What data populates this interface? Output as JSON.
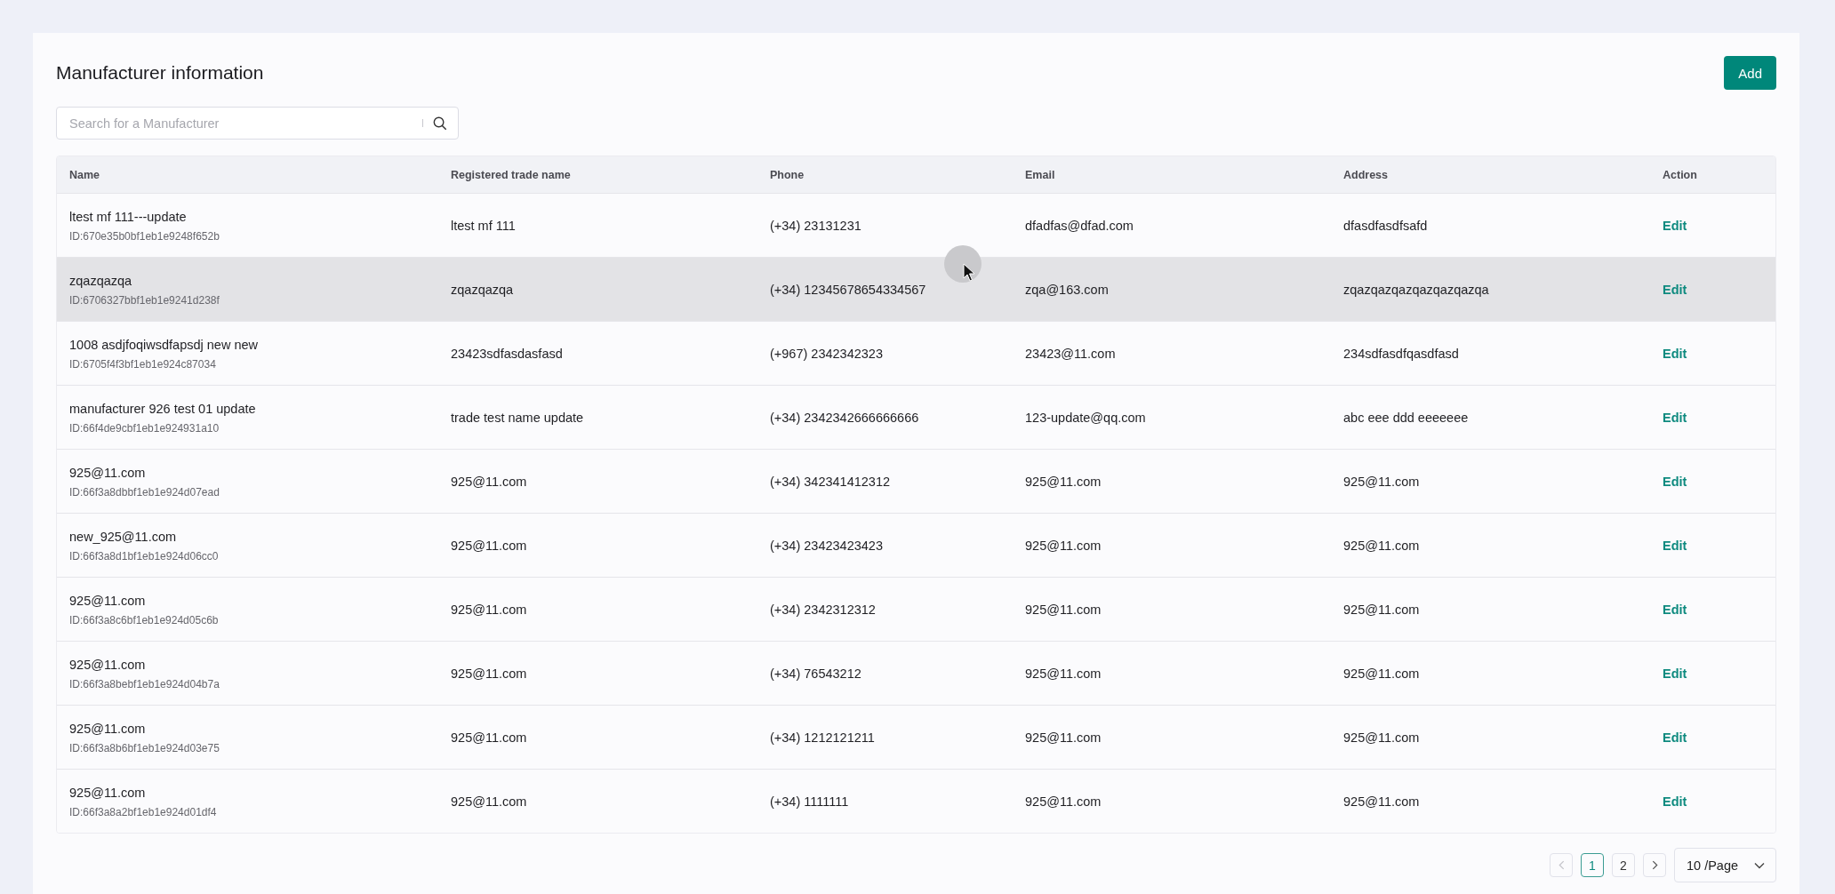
{
  "page": {
    "title": "Manufacturer information",
    "add_button": "Add"
  },
  "search": {
    "placeholder": "Search for a Manufacturer"
  },
  "table": {
    "columns": [
      "Name",
      "Registered trade name",
      "Phone",
      "Email",
      "Address",
      "Action"
    ],
    "rows": [
      {
        "name": "ltest mf 111---update",
        "id": "ID:670e35b0bf1eb1e9248f652b",
        "trade_name": "ltest mf 111",
        "phone": "(+34) 23131231",
        "email": "dfadfas@dfad.com",
        "address": "dfasdfasdfsafd",
        "action": "Edit",
        "highlighted": false
      },
      {
        "name": "zqazqazqa",
        "id": "ID:6706327bbf1eb1e9241d238f",
        "trade_name": "zqazqazqa",
        "phone": "(+34) 12345678654334567",
        "email": "zqa@163.com",
        "address": "zqazqazqazqazqazqazqa",
        "action": "Edit",
        "highlighted": true
      },
      {
        "name": "1008 asdjfoqiwsdfapsdj new new",
        "id": "ID:6705f4f3bf1eb1e924c87034",
        "trade_name": "23423sdfasdasfasd",
        "phone": "(+967) 2342342323",
        "email": "23423@11.com",
        "address": "234sdfasdfqasdfasd",
        "action": "Edit",
        "highlighted": false
      },
      {
        "name": "manufacturer 926 test 01 update",
        "id": "ID:66f4de9cbf1eb1e924931a10",
        "trade_name": "trade test name update",
        "phone": "(+34) 2342342666666666",
        "email": "123-update@qq.com",
        "address": "abc eee ddd eeeeeee",
        "action": "Edit",
        "highlighted": false
      },
      {
        "name": "925@11.com",
        "id": "ID:66f3a8dbbf1eb1e924d07ead",
        "trade_name": "925@11.com",
        "phone": "(+34) 342341412312",
        "email": "925@11.com",
        "address": "925@11.com",
        "action": "Edit",
        "highlighted": false
      },
      {
        "name": "new_925@11.com",
        "id": "ID:66f3a8d1bf1eb1e924d06cc0",
        "trade_name": "925@11.com",
        "phone": "(+34) 23423423423",
        "email": "925@11.com",
        "address": "925@11.com",
        "action": "Edit",
        "highlighted": false
      },
      {
        "name": "925@11.com",
        "id": "ID:66f3a8c6bf1eb1e924d05c6b",
        "trade_name": "925@11.com",
        "phone": "(+34) 2342312312",
        "email": "925@11.com",
        "address": "925@11.com",
        "action": "Edit",
        "highlighted": false
      },
      {
        "name": "925@11.com",
        "id": "ID:66f3a8bebf1eb1e924d04b7a",
        "trade_name": "925@11.com",
        "phone": "(+34) 76543212",
        "email": "925@11.com",
        "address": "925@11.com",
        "action": "Edit",
        "highlighted": false
      },
      {
        "name": "925@11.com",
        "id": "ID:66f3a8b6bf1eb1e924d03e75",
        "trade_name": "925@11.com",
        "phone": "(+34) 1212121211",
        "email": "925@11.com",
        "address": "925@11.com",
        "action": "Edit",
        "highlighted": false
      },
      {
        "name": "925@11.com",
        "id": "ID:66f3a8a2bf1eb1e924d01df4",
        "trade_name": "925@11.com",
        "phone": "(+34) 1111111",
        "email": "925@11.com",
        "address": "925@11.com",
        "action": "Edit",
        "highlighted": false
      }
    ]
  },
  "pagination": {
    "previous": {
      "disabled": true
    },
    "pages": [
      {
        "label": "1",
        "selected": true
      },
      {
        "label": "2",
        "selected": false
      }
    ],
    "next": {
      "disabled": false
    },
    "page_size": "10 /Page"
  }
}
